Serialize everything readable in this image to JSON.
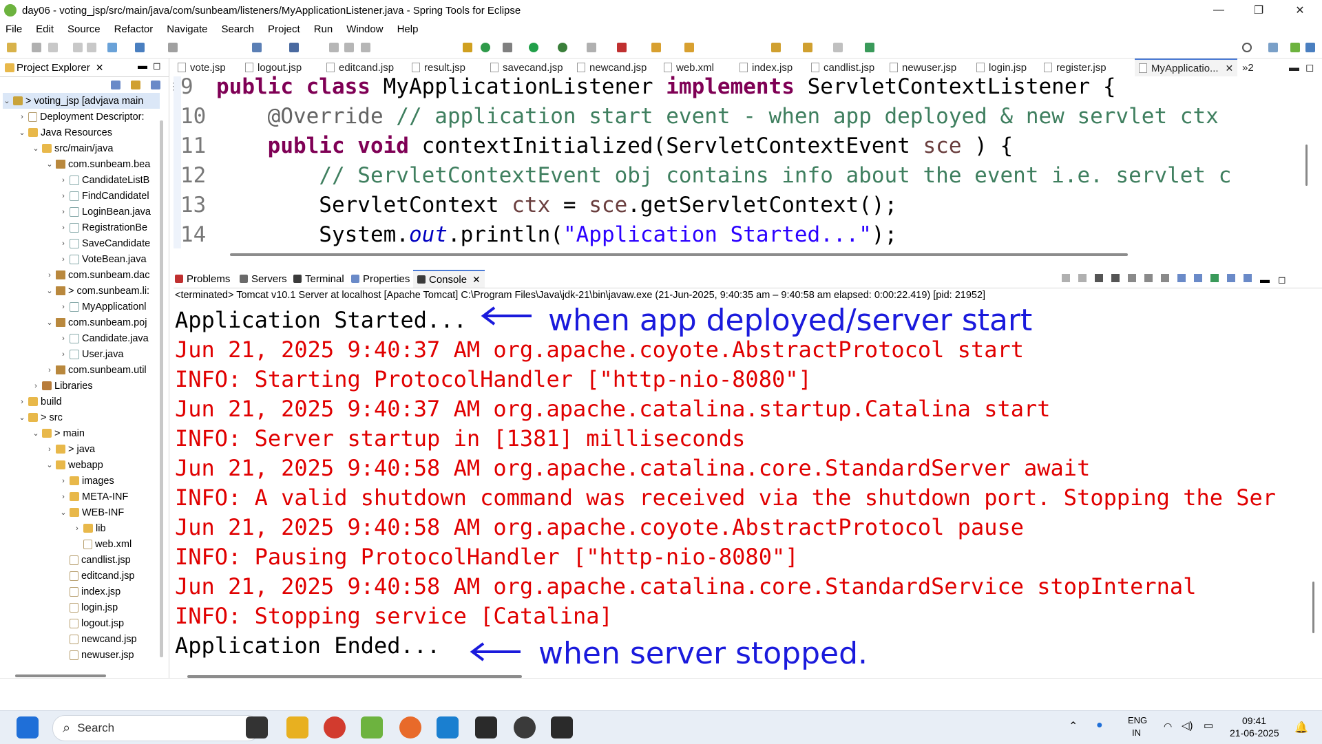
{
  "window": {
    "title": "day06 - voting_jsp/src/main/java/com/sunbeam/listeners/MyApplicationListener.java - Spring Tools for Eclipse",
    "minimize": "—",
    "maximize": "❐",
    "close": "✕"
  },
  "menu": [
    "File",
    "Edit",
    "Source",
    "Refactor",
    "Navigate",
    "Search",
    "Project",
    "Run",
    "Window",
    "Help"
  ],
  "project_explorer": {
    "tab_label": "Project Explorer",
    "close": "✕",
    "items": [
      {
        "label": "> voting_jsp [advjava main",
        "arrow": "⌄",
        "icon": "project-icon"
      },
      {
        "label": "Deployment Descriptor:",
        "arrow": "›",
        "icon": "deployment-descriptor-icon"
      },
      {
        "label": "Java Resources",
        "arrow": "⌄",
        "icon": "java-resources-icon"
      },
      {
        "label": "src/main/java",
        "arrow": "⌄",
        "icon": "source-folder-icon"
      },
      {
        "label": "com.sunbeam.bea",
        "arrow": "⌄",
        "icon": "package-icon"
      },
      {
        "label": "CandidateListB",
        "arrow": "›",
        "icon": "java-file-icon"
      },
      {
        "label": "FindCandidatel",
        "arrow": "›",
        "icon": "java-file-icon"
      },
      {
        "label": "LoginBean.java",
        "arrow": "›",
        "icon": "java-file-icon"
      },
      {
        "label": "RegistrationBe",
        "arrow": "›",
        "icon": "java-file-icon"
      },
      {
        "label": "SaveCandidate",
        "arrow": "›",
        "icon": "java-file-icon"
      },
      {
        "label": "VoteBean.java",
        "arrow": "›",
        "icon": "java-file-icon"
      },
      {
        "label": "com.sunbeam.dac",
        "arrow": "›",
        "icon": "package-icon"
      },
      {
        "label": "> com.sunbeam.li:",
        "arrow": "⌄",
        "icon": "package-icon"
      },
      {
        "label": "MyApplicationl",
        "arrow": "›",
        "icon": "java-file-icon"
      },
      {
        "label": "com.sunbeam.poj",
        "arrow": "⌄",
        "icon": "package-icon"
      },
      {
        "label": "Candidate.java",
        "arrow": "›",
        "icon": "java-file-icon"
      },
      {
        "label": "User.java",
        "arrow": "›",
        "icon": "java-file-icon"
      },
      {
        "label": "com.sunbeam.util",
        "arrow": "›",
        "icon": "package-icon"
      },
      {
        "label": "Libraries",
        "arrow": "›",
        "icon": "library-icon"
      },
      {
        "label": "build",
        "arrow": "›",
        "icon": "folder-icon"
      },
      {
        "label": "> src",
        "arrow": "⌄",
        "icon": "folder-icon"
      },
      {
        "label": "> main",
        "arrow": "⌄",
        "icon": "folder-icon"
      },
      {
        "label": "> java",
        "arrow": "›",
        "icon": "folder-icon"
      },
      {
        "label": "webapp",
        "arrow": "⌄",
        "icon": "folder-icon"
      },
      {
        "label": "images",
        "arrow": "›",
        "icon": "folder-icon"
      },
      {
        "label": "META-INF",
        "arrow": "›",
        "icon": "folder-icon"
      },
      {
        "label": "WEB-INF",
        "arrow": "⌄",
        "icon": "folder-icon"
      },
      {
        "label": "lib",
        "arrow": "›",
        "icon": "folder-icon"
      },
      {
        "label": "web.xml",
        "arrow": "",
        "icon": "xml-file-icon"
      },
      {
        "label": "candlist.jsp",
        "arrow": "",
        "icon": "jsp-file-icon"
      },
      {
        "label": "editcand.jsp",
        "arrow": "",
        "icon": "jsp-file-icon"
      },
      {
        "label": "index.jsp",
        "arrow": "",
        "icon": "jsp-file-icon"
      },
      {
        "label": "login.jsp",
        "arrow": "",
        "icon": "jsp-file-icon"
      },
      {
        "label": "logout.jsp",
        "arrow": "",
        "icon": "jsp-file-icon"
      },
      {
        "label": "newcand.jsp",
        "arrow": "",
        "icon": "jsp-file-icon"
      },
      {
        "label": "newuser.jsp",
        "arrow": "",
        "icon": "jsp-file-icon"
      }
    ]
  },
  "editor_tabs": [
    "vote.jsp",
    "logout.jsp",
    "editcand.jsp",
    "result.jsp",
    "savecand.jsp",
    "newcand.jsp",
    "web.xml",
    "index.jsp",
    "candlist.jsp",
    "newuser.jsp",
    "login.jsp",
    "register.jsp",
    "MyApplicatio..."
  ],
  "editor_overflow": "»2",
  "code_lines": [
    {
      "num": "9",
      "parts": [
        [
          "kw",
          "public class "
        ],
        [
          "",
          "MyApplicationListener "
        ],
        [
          "kw",
          "implements "
        ],
        [
          "",
          "ServletContextListener {"
        ]
      ]
    },
    {
      "num": "10",
      "parts": [
        [
          "",
          "    "
        ],
        [
          "an",
          "@Override"
        ],
        [
          "cm",
          " // application start event - when app deployed & new servlet ctx"
        ]
      ]
    },
    {
      "num": "11",
      "parts": [
        [
          "",
          "    "
        ],
        [
          "kw",
          "public void "
        ],
        [
          "",
          "contextInitialized(ServletContextEvent "
        ],
        [
          "lv",
          "sce"
        ],
        [
          "",
          " ) {"
        ]
      ]
    },
    {
      "num": "12",
      "parts": [
        [
          "",
          "        "
        ],
        [
          "cm",
          "// ServletContextEvent obj contains info about the event i.e. servlet c"
        ]
      ]
    },
    {
      "num": "13",
      "parts": [
        [
          "",
          "        ServletContext "
        ],
        [
          "lv",
          "ctx"
        ],
        [
          "",
          " = "
        ],
        [
          "lv",
          "sce"
        ],
        [
          "",
          ".getServletContext();"
        ]
      ]
    },
    {
      "num": "14",
      "parts": [
        [
          "",
          "        System."
        ],
        [
          "fld",
          "out"
        ],
        [
          "",
          ".println("
        ],
        [
          "str",
          "\"Application Started...\""
        ],
        [
          "",
          ");"
        ]
      ]
    }
  ],
  "console_tabs": [
    "Problems",
    "Servers",
    "Terminal",
    "Properties",
    "Console"
  ],
  "console_close": "✕",
  "console_description": "<terminated> Tomcat v10.1 Server at localhost [Apache Tomcat] C:\\Program Files\\Java\\jdk-21\\bin\\javaw.exe  (21-Jun-2025, 9:40:35 am – 9:40:58 am elapsed: 0:00:22.419) [pid: 21952]",
  "console_lines": [
    {
      "text": "Application Started...",
      "color": "black"
    },
    {
      "text": "Jun 21, 2025 9:40:37 AM org.apache.coyote.AbstractProtocol start",
      "color": "red"
    },
    {
      "text": "INFO: Starting ProtocolHandler [\"http-nio-8080\"]",
      "color": "red"
    },
    {
      "text": "Jun 21, 2025 9:40:37 AM org.apache.catalina.startup.Catalina start",
      "color": "red"
    },
    {
      "text": "INFO: Server startup in [1381] milliseconds",
      "color": "red"
    },
    {
      "text": "Jun 21, 2025 9:40:58 AM org.apache.catalina.core.StandardServer await",
      "color": "red"
    },
    {
      "text": "INFO: A valid shutdown command was received via the shutdown port. Stopping the Ser",
      "color": "red"
    },
    {
      "text": "Jun 21, 2025 9:40:58 AM org.apache.coyote.AbstractProtocol pause",
      "color": "red"
    },
    {
      "text": "INFO: Pausing ProtocolHandler [\"http-nio-8080\"]",
      "color": "red"
    },
    {
      "text": "Jun 21, 2025 9:40:58 AM org.apache.catalina.core.StandardService stopInternal",
      "color": "red"
    },
    {
      "text": "INFO: Stopping service [Catalina]",
      "color": "red"
    },
    {
      "text": "Application Ended...",
      "color": "black"
    }
  ],
  "annotations": {
    "start_note": "when app deployed/server start",
    "end_note": "when server stopped."
  },
  "taskbar": {
    "search_placeholder": "Search",
    "language": "ENG",
    "region": "IN",
    "time": "09:41",
    "date": "21-06-2025"
  },
  "colors": {
    "console_error": "#e00000",
    "annotation": "#1a1adc",
    "keyword": "#7f0055",
    "comment": "#3f7f5f",
    "string": "#2a00ff"
  }
}
